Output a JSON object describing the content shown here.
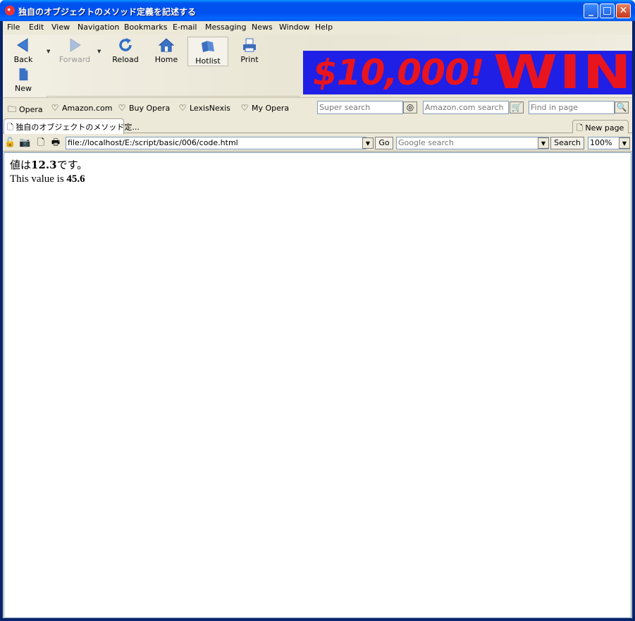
{
  "window": {
    "title": "独自のオブジェクトのメソッド定義を記述する",
    "minimize": "_",
    "maximize": "□",
    "close": "✕"
  },
  "menu": [
    "File",
    "Edit",
    "View",
    "Navigation",
    "Bookmarks",
    "E-mail",
    "Messaging",
    "News",
    "Window",
    "Help"
  ],
  "toolbar": {
    "back": "Back",
    "forward": "Forward",
    "reload": "Reload",
    "home": "Home",
    "hotlist": "Hotlist",
    "print": "Print",
    "new": "New"
  },
  "banner": {
    "amount": "$10,000!",
    "word": "WIN"
  },
  "bookmarks": {
    "items": [
      "Opera",
      "Amazon.com",
      "Buy Opera",
      "LexisNexis",
      "My Opera"
    ],
    "super_search_placeholder": "Super search",
    "amazon_search_placeholder": "Amazon.com search",
    "find_placeholder": "Find in page"
  },
  "tabs": {
    "active_tab": "独自のオブジェクトのメソッド定...",
    "new_page": "New page"
  },
  "address": {
    "url": "file://localhost/E:/script/basic/006/code.html",
    "go": "Go",
    "google_placeholder": "Google search",
    "search_button": "Search",
    "zoom": "100%"
  },
  "content": {
    "line1_prefix": "値は",
    "line1_value": "12.3",
    "line1_suffix": "です。",
    "line2_prefix": "This value is ",
    "line2_value": "45.6"
  },
  "colors": {
    "title_bar": "#0053ee",
    "banner_bg": "#1f1fe6",
    "banner_text": "#e8141e"
  }
}
